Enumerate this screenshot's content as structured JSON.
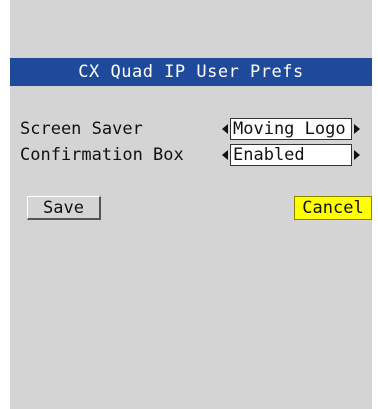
{
  "dialog": {
    "title": "CX Quad IP User Prefs"
  },
  "settings": [
    {
      "label": "Screen Saver",
      "value": "Moving Logo",
      "prev_icon": "left-triangle-icon",
      "next_icon": "right-triangle-icon"
    },
    {
      "label": "Confirmation Box",
      "value": "Enabled",
      "prev_icon": "left-triangle-icon",
      "next_icon": "right-triangle-icon"
    }
  ],
  "buttons": {
    "save_label": "Save",
    "cancel_label": "Cancel"
  },
  "colors": {
    "panel_bg": "#d4d4d4",
    "title_bg": "#1f4a9c",
    "title_text": "#ffffff",
    "cancel_bg": "#ffff00"
  }
}
